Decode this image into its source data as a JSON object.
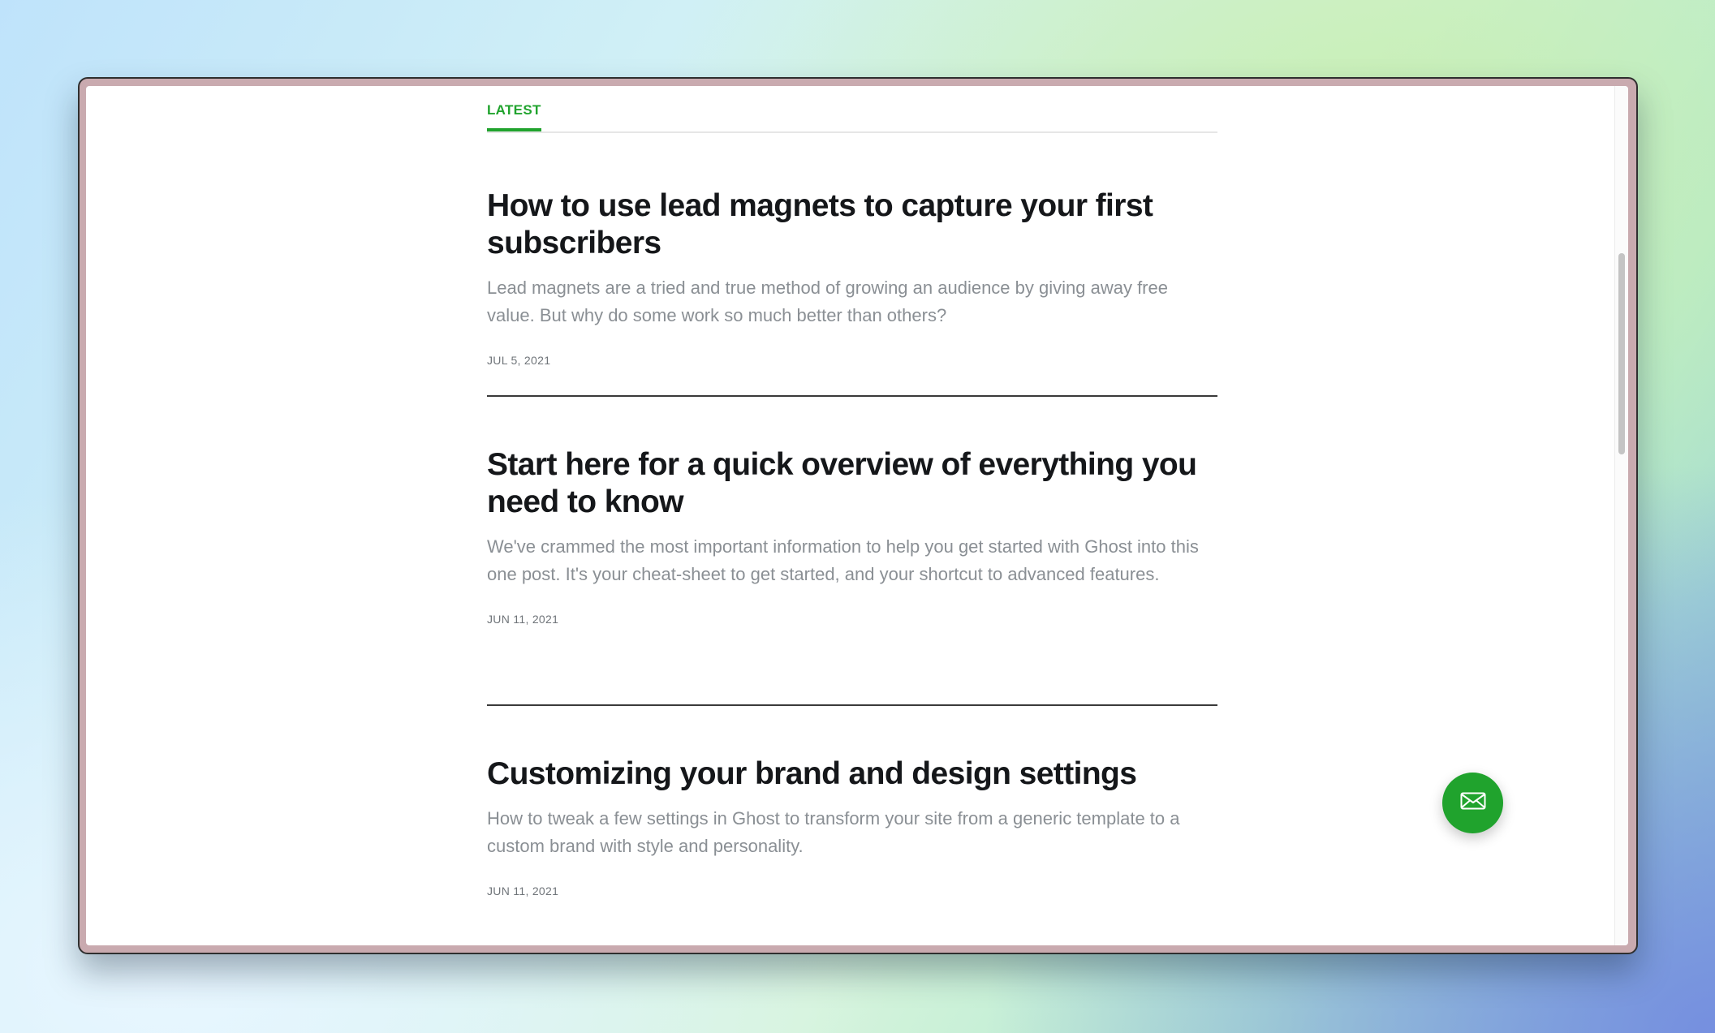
{
  "tabs": {
    "active_label": "LATEST"
  },
  "posts": [
    {
      "title": "How to use lead magnets to capture your first subscribers",
      "excerpt": "Lead magnets are a tried and true method of growing an audience by giving away free value. But why do some work so much better than others?",
      "date": "JUL 5, 2021"
    },
    {
      "title": "Start here for a quick overview of everything you need to know",
      "excerpt": "We've crammed the most important information to help you get started with Ghost into this one post. It's your cheat-sheet to get started, and your shortcut to advanced features.",
      "date": "JUN 11, 2021"
    },
    {
      "title": "Customizing your brand and design settings",
      "excerpt": "How to tweak a few settings in Ghost to transform your site from a generic template to a custom brand with style and personality.",
      "date": "JUN 11, 2021"
    }
  ],
  "fab": {
    "icon": "envelope-icon"
  },
  "colors": {
    "accent": "#20a32d",
    "title": "#15171a",
    "excerpt": "#8a8f94",
    "frame": "#c9aaaf"
  }
}
